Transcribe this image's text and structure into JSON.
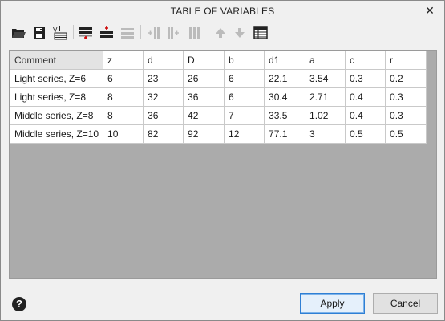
{
  "window": {
    "title": "TABLE OF VARIABLES",
    "close_glyph": "✕"
  },
  "toolbar": {
    "icons": [
      "open-folder-icon",
      "save-icon",
      "variables-import-icon",
      "insert-row-above-icon",
      "insert-row-below-icon",
      "delete-row-icon",
      "insert-column-left-icon",
      "insert-column-right-icon",
      "delete-column-icon",
      "move-up-icon",
      "move-down-icon",
      "table-properties-icon"
    ]
  },
  "table": {
    "columns": [
      "Comment",
      "z",
      "d",
      "D",
      "b",
      "d1",
      "a",
      "c",
      "r"
    ],
    "rows": [
      [
        "Light series, Z=6",
        "6",
        "23",
        "26",
        "6",
        "22.1",
        "3.54",
        "0.3",
        "0.2"
      ],
      [
        "Light series, Z=8",
        "8",
        "32",
        "36",
        "6",
        "30.4",
        "2.71",
        "0.4",
        "0.3"
      ],
      [
        "Middle series, Z=8",
        "8",
        "36",
        "42",
        "7",
        "33.5",
        "1.02",
        "0.4",
        "0.3"
      ],
      [
        "Middle series, Z=10",
        "10",
        "82",
        "92",
        "12",
        "77.1",
        "3",
        "0.5",
        "0.5"
      ]
    ]
  },
  "buttons": {
    "apply": "Apply",
    "cancel": "Cancel",
    "help": "?"
  },
  "colors": {
    "accent": "#2f7fd4",
    "grid_bg": "#ababab",
    "header_bg": "#e3e3e3"
  }
}
